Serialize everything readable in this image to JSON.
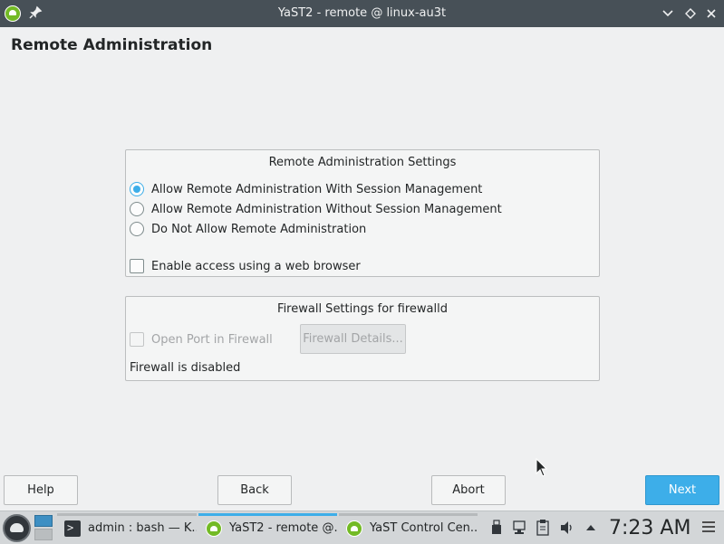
{
  "window": {
    "title": "YaST2 - remote @ linux-au3t"
  },
  "page": {
    "title": "Remote Administration"
  },
  "remote_settings": {
    "title": "Remote Administration Settings",
    "options": [
      {
        "label": "Allow Remote Administration With Session Management",
        "checked": true
      },
      {
        "label": "Allow Remote Administration Without Session Management",
        "checked": false
      },
      {
        "label": "Do Not Allow Remote Administration",
        "checked": false
      }
    ],
    "web_browser_label": "Enable access using a web browser",
    "web_browser_checked": false
  },
  "firewall": {
    "title": "Firewall Settings for firewalld",
    "open_port_label": "Open Port in Firewall",
    "open_port_enabled": false,
    "details_label": "Firewall Details...",
    "status_text": "Firewall is disabled"
  },
  "buttons": {
    "help": "Help",
    "back": "Back",
    "abort": "Abort",
    "next": "Next"
  },
  "taskbar": {
    "tasks": [
      {
        "label": "admin : bash — K...",
        "icon": "terminal-icon",
        "active": false
      },
      {
        "label": "YaST2 - remote @...",
        "icon": "yast-icon",
        "active": true
      },
      {
        "label": "YaST Control Cen...",
        "icon": "yast-icon",
        "active": false
      }
    ],
    "clock": "7:23 AM"
  },
  "colors": {
    "accent": "#3daee9",
    "titlebar": "#475057",
    "yast_green": "#73ba25"
  }
}
